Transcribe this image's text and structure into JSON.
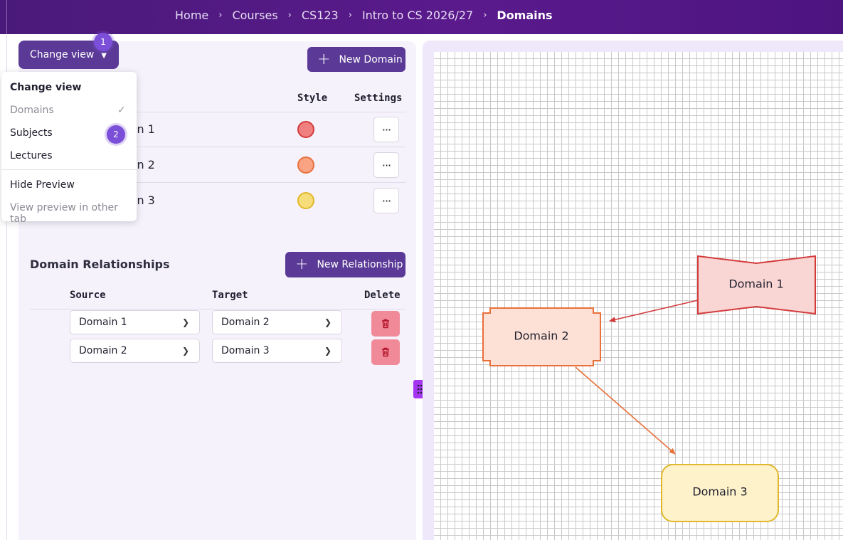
{
  "breadcrumb": [
    "Home",
    "Courses",
    "CS123",
    "Intro to CS 2026/27",
    "Domains"
  ],
  "breadcrumb_separator": "›",
  "change_view": {
    "label": "Change view",
    "badge_1": "1",
    "badge_2": "2",
    "menu": {
      "header": "Change view",
      "items": [
        "Domains",
        "Subjects",
        "Lectures"
      ],
      "selected": "Domains",
      "hide_preview": "Hide Preview",
      "view_preview_other_tab": "View preview in other tab"
    }
  },
  "domains_table": {
    "new_button": "New Domain",
    "columns": {
      "style": "Style",
      "settings": "Settings"
    },
    "rows": [
      {
        "name_partial": "in 1",
        "style_color": "#f08080",
        "style_border": "#d33b3b"
      },
      {
        "name_partial": "in 2",
        "style_color": "#f9a384",
        "style_border": "#e8703a"
      },
      {
        "name_partial": "in 3",
        "style_color": "#f7dc7a",
        "style_border": "#e0b82a"
      }
    ],
    "settings_label": "···"
  },
  "relationships": {
    "title": "Domain Relationships",
    "new_button": "New Relationship",
    "columns": {
      "source": "Source",
      "target": "Target",
      "delete": "Delete"
    },
    "rows": [
      {
        "source": "Domain 1",
        "target": "Domain 2"
      },
      {
        "source": "Domain 2",
        "target": "Domain 3"
      }
    ]
  },
  "diagram": {
    "nodes": [
      {
        "label": "Domain 1",
        "fill": "#f9d5d3",
        "stroke": "#d33b3b"
      },
      {
        "label": "Domain 2",
        "fill": "#fde1d6",
        "stroke": "#e8703a"
      },
      {
        "label": "Domain 3",
        "fill": "#fdf2c9",
        "stroke": "#e0b82a"
      }
    ],
    "edge_colors": [
      "#d33b3b",
      "#e8703a"
    ]
  },
  "colors": {
    "topbar": "#5a1a8c",
    "primary_button": "#5a3a96",
    "badge": "#7b4fd8",
    "delete_button": "#f08a98",
    "handle": "#a435f0",
    "panel_background": "#f6f2fc"
  }
}
